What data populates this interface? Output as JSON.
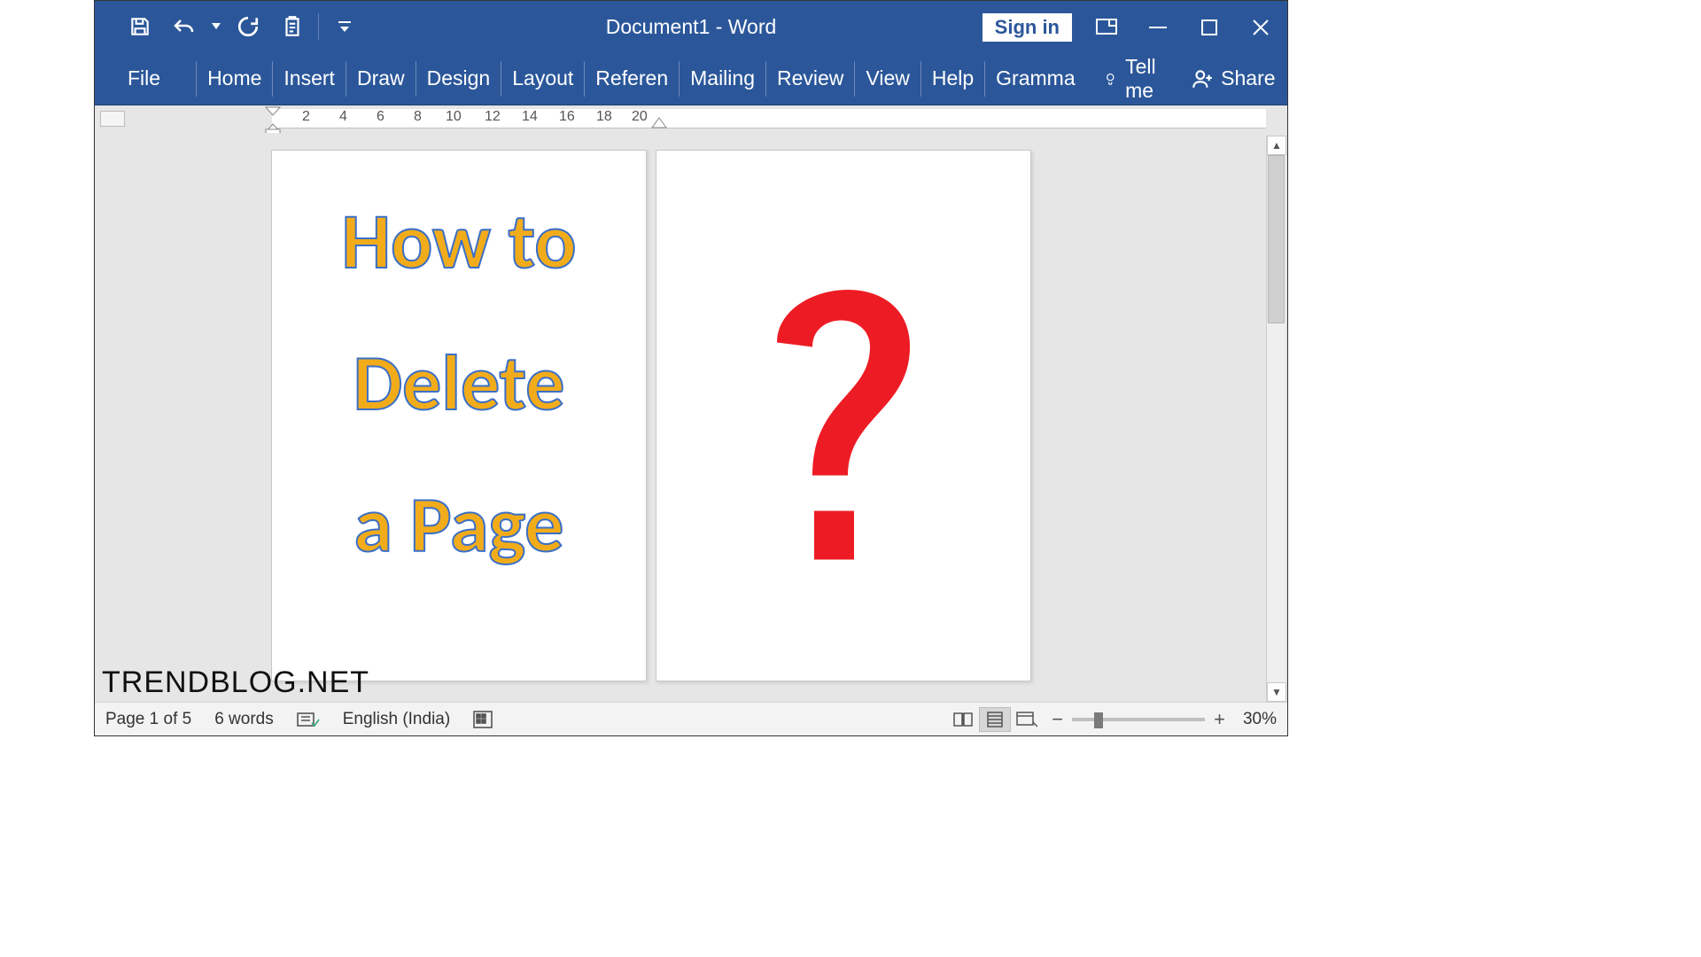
{
  "titlebar": {
    "document_title": "Document1  -  Word",
    "signin_label": "Sign in"
  },
  "ribbon": {
    "file_label": "File",
    "tabs": [
      "Home",
      "Insert",
      "Draw",
      "Design",
      "Layout",
      "Referen",
      "Mailing",
      "Review",
      "View",
      "Help",
      "Gramma"
    ],
    "tell_me": "Tell me",
    "share": "Share"
  },
  "ruler": {
    "numbers": [
      "2",
      "4",
      "6",
      "8",
      "10",
      "12",
      "14",
      "16",
      "18",
      "20"
    ]
  },
  "document": {
    "page1_lines": [
      "How to",
      "Delete",
      "a Page"
    ],
    "page2_symbol": "?"
  },
  "statusbar": {
    "page_info": "Page 1 of 5",
    "word_count": "6 words",
    "language": "English (India)",
    "zoom": "30%"
  },
  "watermark": "TRENDBLOG.NET"
}
